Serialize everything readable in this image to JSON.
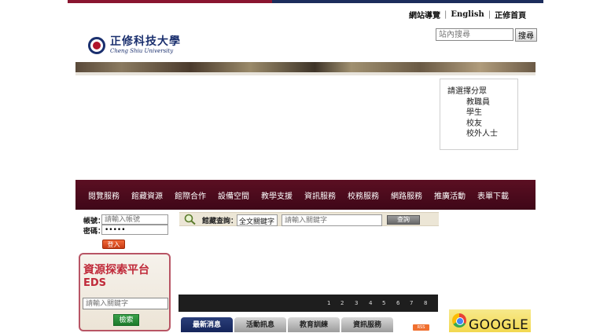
{
  "header": {
    "links": [
      "網站導覽",
      "English",
      "正修首頁"
    ],
    "search_placeholder": "站內搜尋",
    "search_button": "搜尋"
  },
  "logo": {
    "title_zh": "正修科技大學",
    "title_en": "Cheng Shiu University"
  },
  "role_menu": {
    "title": "請選擇分眾",
    "items": [
      "教職員",
      "學生",
      "校友",
      "校外人士"
    ]
  },
  "nav": {
    "items": [
      "閱覽服務",
      "館藏資源",
      "館際合作",
      "設備空間",
      "教學支援",
      "資訊服務",
      "校務服務",
      "網路服務",
      "推廣活動",
      "表單下載"
    ]
  },
  "login": {
    "account_label": "帳號：",
    "account_placeholder": "請輸入帳號",
    "password_label": "密碼：",
    "password_value": "•••••",
    "submit": "登入"
  },
  "eds": {
    "title": "資源探索平台",
    "subtitle": "EDS",
    "placeholder": "請輸入關鍵字",
    "button": "檢索"
  },
  "catalog": {
    "label": "館藏查詢",
    "separator": "：",
    "select_value": "全文關鍵字",
    "placeholder": "請輸入關鍵字",
    "button": "查詢"
  },
  "slider": {
    "pages": [
      "1",
      "2",
      "3",
      "4",
      "5",
      "6",
      "7",
      "8"
    ]
  },
  "news_tabs": {
    "tabs": [
      "最新消息",
      "活動訊息",
      "教育訓練",
      "資訊服務"
    ],
    "rss": "RSS"
  },
  "google_banner": {
    "text": "GOOGLE"
  },
  "colors": {
    "nav_bg": "#4d0b1d",
    "accent_red": "#c02a3a",
    "navy": "#1a2f6e"
  }
}
